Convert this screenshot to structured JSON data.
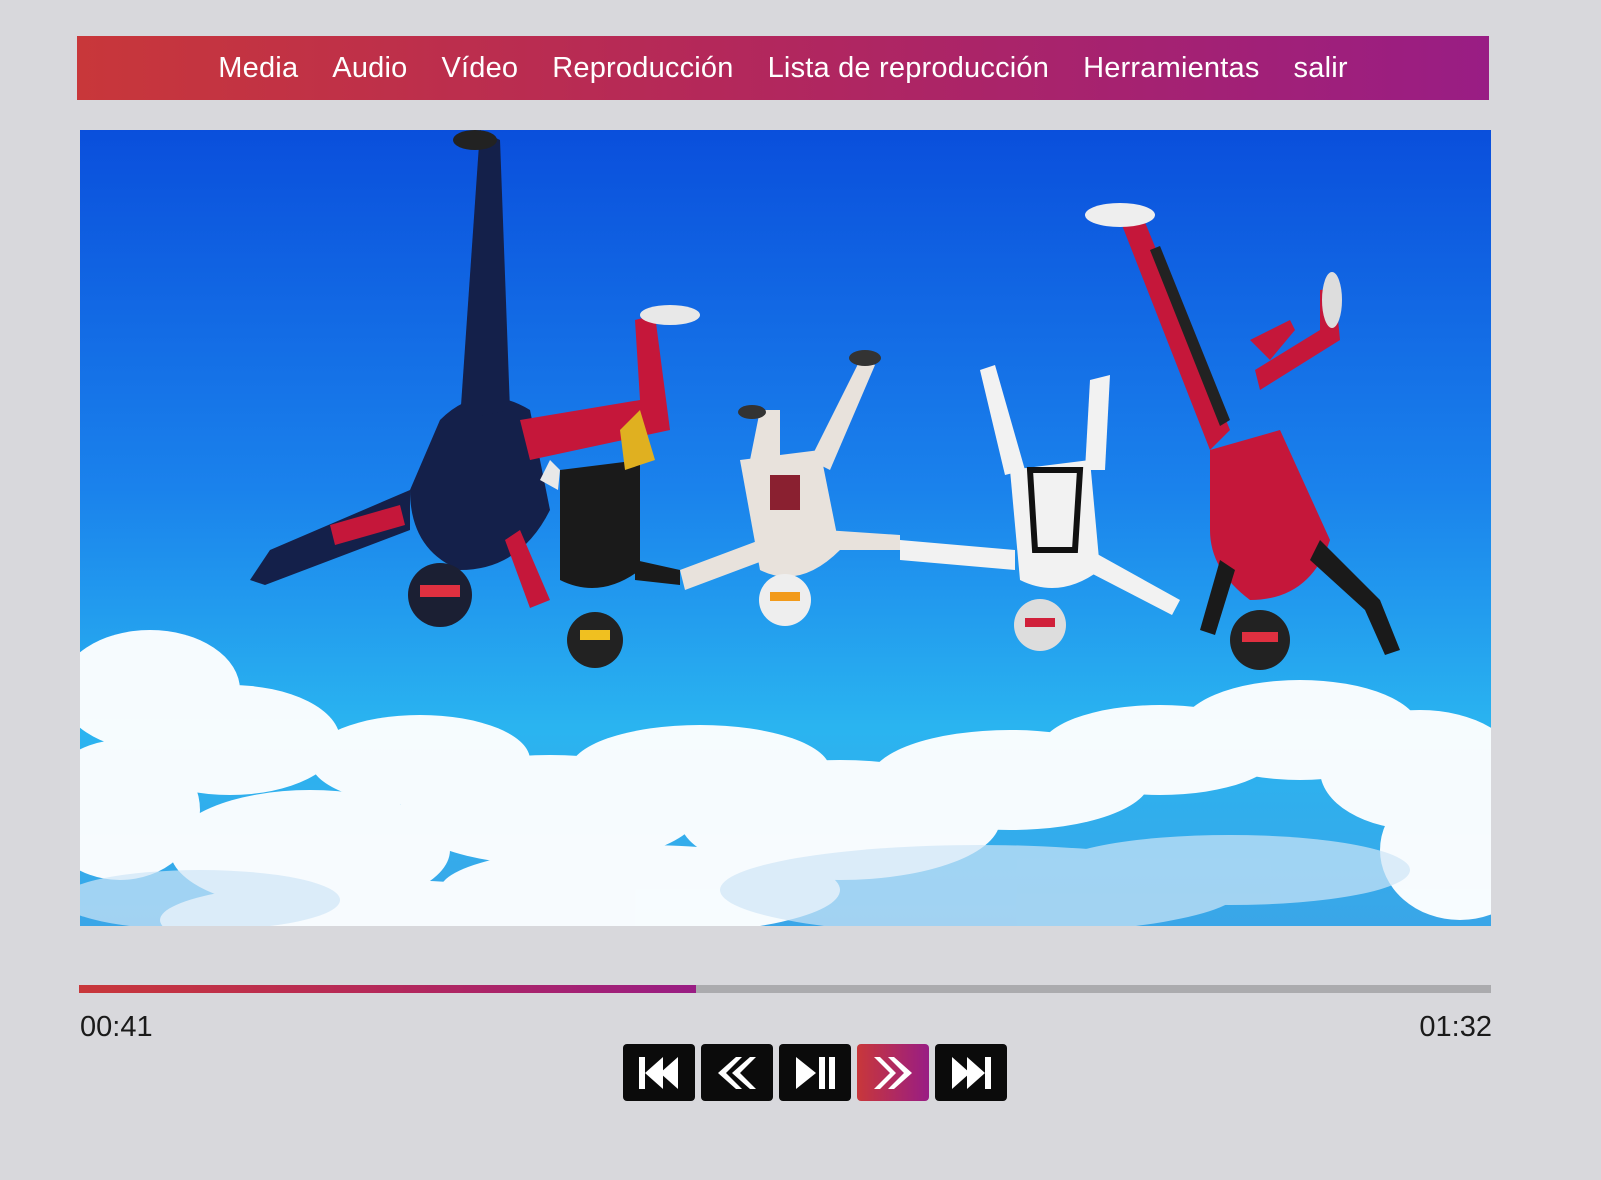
{
  "menu": {
    "items": [
      {
        "label": "Media"
      },
      {
        "label": "Audio"
      },
      {
        "label": "Vídeo"
      },
      {
        "label": "Reproducción"
      },
      {
        "label": "Lista de reproducción"
      },
      {
        "label": "Herramientas"
      },
      {
        "label": "salir"
      }
    ]
  },
  "player": {
    "current_time": "00:41",
    "total_time": "01:32",
    "progress_fraction": 0.437
  },
  "controls": [
    {
      "icon": "skip-to-start-icon",
      "active": false
    },
    {
      "icon": "rewind-icon",
      "active": false
    },
    {
      "icon": "play-pause-icon",
      "active": false
    },
    {
      "icon": "fast-forward-icon",
      "active": true
    },
    {
      "icon": "skip-to-end-icon",
      "active": false
    }
  ],
  "colors": {
    "accent_start": "#c8373a",
    "accent_end": "#991d84",
    "background": "#d8d8dc",
    "track": "#ababae",
    "button": "#0b0b0b"
  }
}
